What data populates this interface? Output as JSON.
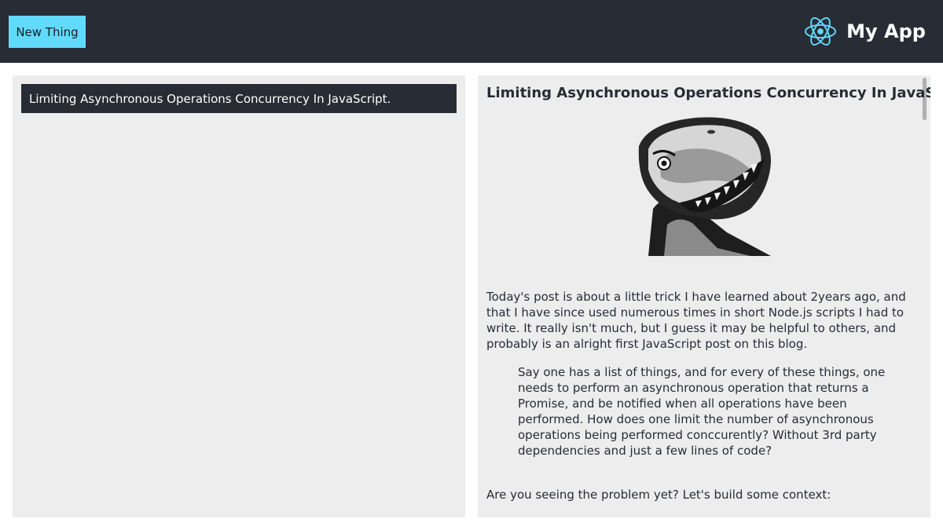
{
  "header": {
    "new_button_label": "New Thing",
    "app_title": "My App",
    "logo_icon": "react-atom-icon",
    "colors": {
      "bar": "#282c34",
      "accent": "#61dafb"
    }
  },
  "list": {
    "items": [
      {
        "label": "Limiting Asynchronous Operations Concurrency In JavaScript."
      }
    ]
  },
  "article": {
    "title": "Limiting Asynchronous Operations Concurrency In JavaScript.",
    "hero_icon": "t-rex-illustration",
    "paragraph_1": "Today's post is about a little trick I have learned about 2years ago, and that I have since used numerous times in short Node.js scripts I had to write. It really isn't much, but I guess it may be helpful to others, and probably is an alright first JavaScript post on this blog.",
    "blockquote": "Say one has a list of things, and for every of these things, one needs to perform an asynchronous operation that returns a Promise, and be notified when all operations have been performed. How does one limit the number of asynchronous operations being performed conccurently? Without 3rd party dependencies and just a few lines of code?",
    "paragraph_2": "Are you seeing the problem yet? Let's build some context:"
  }
}
